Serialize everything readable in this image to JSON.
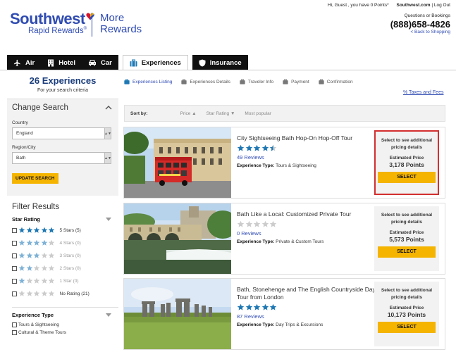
{
  "header": {
    "brand": "Southwest",
    "brand_sub": "Rapid Rewards",
    "more_line1": "More",
    "more_line2": "Rewards",
    "greeting": "Hi, Guest , you have 0 Points*",
    "site_link": "Southwest.com",
    "logout": "Log Out",
    "separator": "|",
    "questions": "Questions or Bookings",
    "phone": "(888)658-4826",
    "back": "< Back to Shopping"
  },
  "tabs": [
    {
      "label": "Air",
      "icon": "plane-icon"
    },
    {
      "label": "Hotel",
      "icon": "hotel-icon"
    },
    {
      "label": "Car",
      "icon": "car-icon"
    },
    {
      "label": "Experiences",
      "icon": "suitcase-icon",
      "active": true
    },
    {
      "label": "Insurance",
      "icon": "shield-icon"
    }
  ],
  "sidebar": {
    "count": "26 Experiences",
    "count_sub": "For your search criteria",
    "change_search": "Change Search",
    "country_label": "Country",
    "country_value": "England",
    "region_label": "Region/City",
    "region_value": "Bath",
    "update_button": "UPDATE SEARCH",
    "filter_title": "Filter Results",
    "star_rating_title": "Star Rating",
    "star_options": [
      {
        "stars": 5,
        "label": "5 Stars (5)"
      },
      {
        "stars": 4,
        "label": "4 Stars (0)"
      },
      {
        "stars": 3,
        "label": "3 Stars (0)"
      },
      {
        "stars": 2,
        "label": "2 Stars (0)"
      },
      {
        "stars": 1,
        "label": "1 Star (0)"
      },
      {
        "stars": 0,
        "label": "No Rating (21)"
      }
    ],
    "exp_type_title": "Experience Type",
    "exp_types": [
      "Tours & Sightseeing",
      "Cultural & Theme Tours"
    ]
  },
  "steps": [
    "Experiences Listing",
    "Experiences Details",
    "Traveler Info",
    "Payment",
    "Confirmation"
  ],
  "taxes": "% Taxes and Fees",
  "sort": {
    "label": "Sort by:",
    "price": "Price ▲",
    "star": "Star Rating ▼",
    "popular": "Most popular"
  },
  "results": [
    {
      "title": "City Sightseeing Bath Hop-On Hop-Off Tour",
      "rating": 4.5,
      "reviews": "49 Reviews",
      "type_label": "Experience Type:",
      "type_value": "Tours & Sightseeing",
      "price_note": "Select to see additional pricing details",
      "est_label": "Estimated Price",
      "points": "3,178 Points",
      "select": "SELECT",
      "highlight": true
    },
    {
      "title": "Bath Like a Local: Customized Private Tour",
      "rating": 0,
      "reviews": "0 Reviews",
      "type_label": "Experience Type:",
      "type_value": "Private & Custom Tours",
      "price_note": "Select to see additional pricing details",
      "est_label": "Estimated Price",
      "points": "5,573 Points",
      "select": "SELECT",
      "highlight": false
    },
    {
      "title": "Bath, Stonehenge and The English Countryside Day Tour from London",
      "rating": 5,
      "reviews": "87 Reviews",
      "type_label": "Experience Type:",
      "type_value": "Day Trips & Excursions",
      "price_note": "Select to see additional pricing details",
      "est_label": "Estimated Price",
      "points": "10,173 Points",
      "select": "SELECT",
      "highlight": false
    }
  ],
  "colors": {
    "brand_blue": "#304cb2",
    "star_blue": "#1e78b4",
    "star_grey": "#cccccc",
    "select_yellow": "#f4b400",
    "highlight_red": "#d32f2f"
  }
}
